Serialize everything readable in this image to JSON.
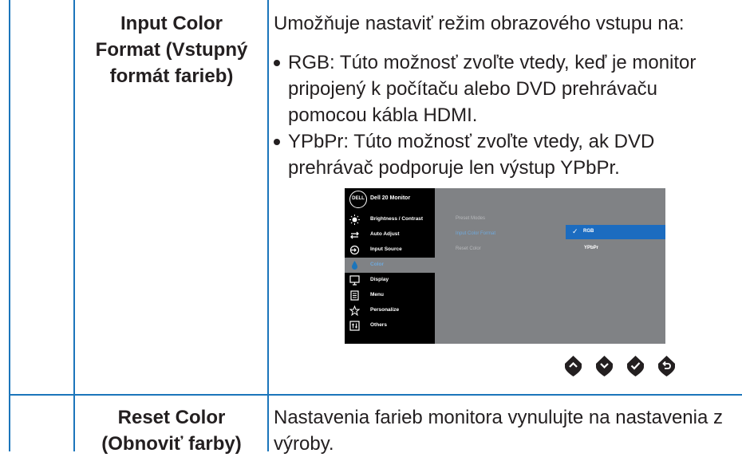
{
  "rows": [
    {
      "term_lines": [
        "Input Color",
        "Format (Vstupný",
        "formát farieb)"
      ],
      "description": "Umožňuje nastaviť režim obrazového vstupu na:",
      "bullets": [
        {
          "lines": [
            "RGB: Túto možnosť zvoľte vtedy, keď je monitor",
            "pripojený k počítaču alebo DVD prehrávaču",
            "pomocou kábla HDMI."
          ]
        },
        {
          "lines": [
            "YPbPr: Túto možnosť zvoľte vtedy, ak DVD",
            "prehrávač podporuje len výstup YPbPr."
          ]
        }
      ]
    },
    {
      "term_lines": [
        "Reset Color",
        "(Obnoviť farby)"
      ],
      "description_lines": [
        "Nastavenia farieb monitora vynulujte na nastavenia z",
        "výroby."
      ]
    }
  ],
  "osd": {
    "logo": "DELL",
    "title": "Dell 20 Monitor",
    "menu": [
      {
        "label": "Brightness / Contrast",
        "icon": "brightness-icon"
      },
      {
        "label": "Auto Adjust",
        "icon": "auto-adjust-icon"
      },
      {
        "label": "Input Source",
        "icon": "input-source-icon"
      },
      {
        "label": "Color",
        "icon": "color-drop-icon",
        "active": true
      },
      {
        "label": "Display",
        "icon": "display-icon"
      },
      {
        "label": "Menu",
        "icon": "menu-icon"
      },
      {
        "label": "Personalize",
        "icon": "star-icon"
      },
      {
        "label": "Others",
        "icon": "others-icon"
      }
    ],
    "submenu": [
      "Preset Modes",
      "Input Color Format",
      "Reset Color"
    ],
    "options": [
      {
        "label": "RGB",
        "selected": true
      },
      {
        "label": "YPbPr",
        "selected": false
      }
    ]
  },
  "nav_buttons": [
    "up-button",
    "down-button",
    "select-button",
    "back-button"
  ],
  "colors": {
    "border": "#1b75bb",
    "osd_bg": "#808285",
    "osd_sidebar": "#000000",
    "highlight": "#1c6cc0"
  }
}
